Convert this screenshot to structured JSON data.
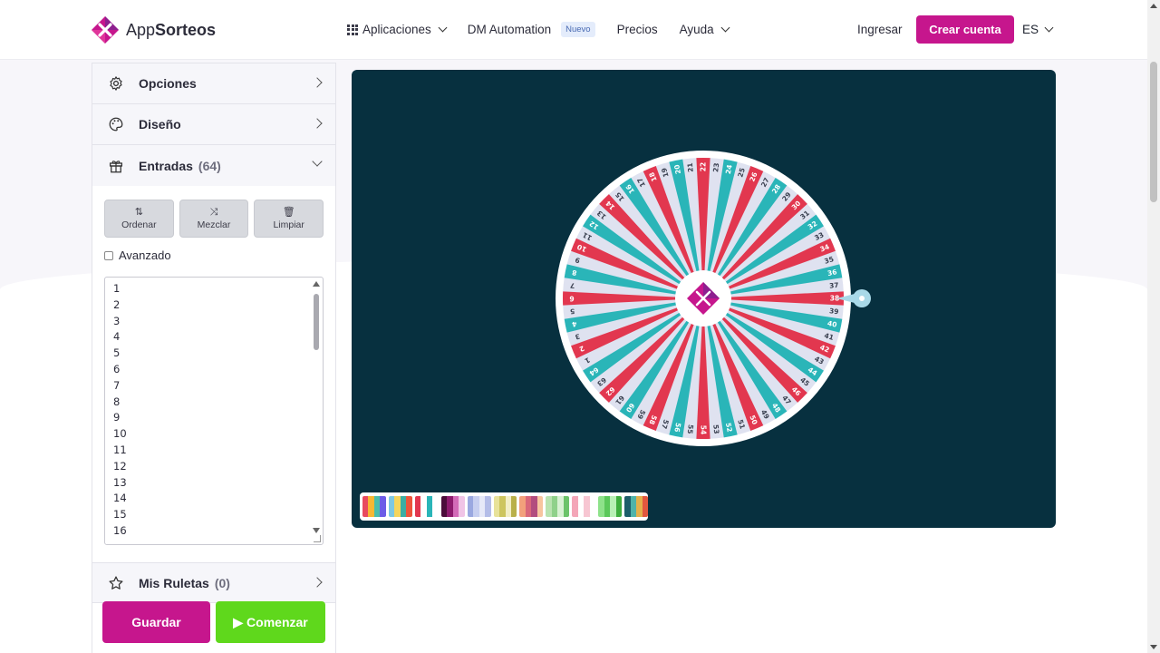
{
  "brand": {
    "name_light": "App",
    "name_bold": "Sorteos"
  },
  "nav": {
    "apps": "Aplicaciones",
    "dm": "DM Automation",
    "dm_badge": "Nuevo",
    "pricing": "Precios",
    "help": "Ayuda"
  },
  "auth": {
    "login": "Ingresar",
    "signup": "Crear cuenta",
    "lang": "ES"
  },
  "sidebar": {
    "options": "Opciones",
    "design": "Diseño",
    "entries": "Entradas",
    "entries_count": "(64)",
    "sort": "Ordenar",
    "shuffle": "Mezclar",
    "clear": "Limpiar",
    "advanced": "Avanzado",
    "entries_text": [
      "1",
      "2",
      "3",
      "4",
      "5",
      "6",
      "7",
      "8",
      "9",
      "10",
      "11",
      "12",
      "13",
      "14",
      "15",
      "16"
    ],
    "my_wheels": "Mis Ruletas",
    "my_wheels_count": "(0)",
    "save": "Guardar",
    "start": "Comenzar"
  },
  "wheel": {
    "segments": 64,
    "pattern": [
      "#e2374f",
      "#ffffff",
      "#2ab5b8",
      "#ffffff"
    ],
    "labels_start": 1,
    "labels_end": 64,
    "colors": {
      "stage": "#07303f",
      "brand": "#c6168d",
      "accent_green": "#5fd81c"
    }
  },
  "palettes": [
    [
      "#e84a5f",
      "#f7b733",
      "#4abdac",
      "#6c5ce7"
    ],
    [
      "#7ec8e3",
      "#f6d55c",
      "#3caea3",
      "#ed553b"
    ],
    [
      "#e2374f",
      "#ffffff",
      "#2ab5b8",
      "#ffffff"
    ],
    [
      "#4b0d3a",
      "#8e1b6e",
      "#d36bb8",
      "#f0c4e6"
    ],
    [
      "#9aa8e0",
      "#c7cff0",
      "#e6e9f8",
      "#b4bde8"
    ],
    [
      "#e8e29a",
      "#cdc55e",
      "#f2eec5",
      "#b9b04a"
    ],
    [
      "#f2a07b",
      "#d9677a",
      "#b24d7e",
      "#f7c59f"
    ],
    [
      "#b9e3b0",
      "#8fd18a",
      "#d8f1d3",
      "#6cc36a"
    ],
    [
      "#f4a6b8",
      "#ffffff",
      "#f7c6d2",
      "#ffffff"
    ],
    [
      "#8ee28a",
      "#5bc85a",
      "#b8f0b5",
      "#3fae3e"
    ],
    [
      "#1d5e6a",
      "#4fb3a9",
      "#e3b04b",
      "#e1573f"
    ]
  ]
}
